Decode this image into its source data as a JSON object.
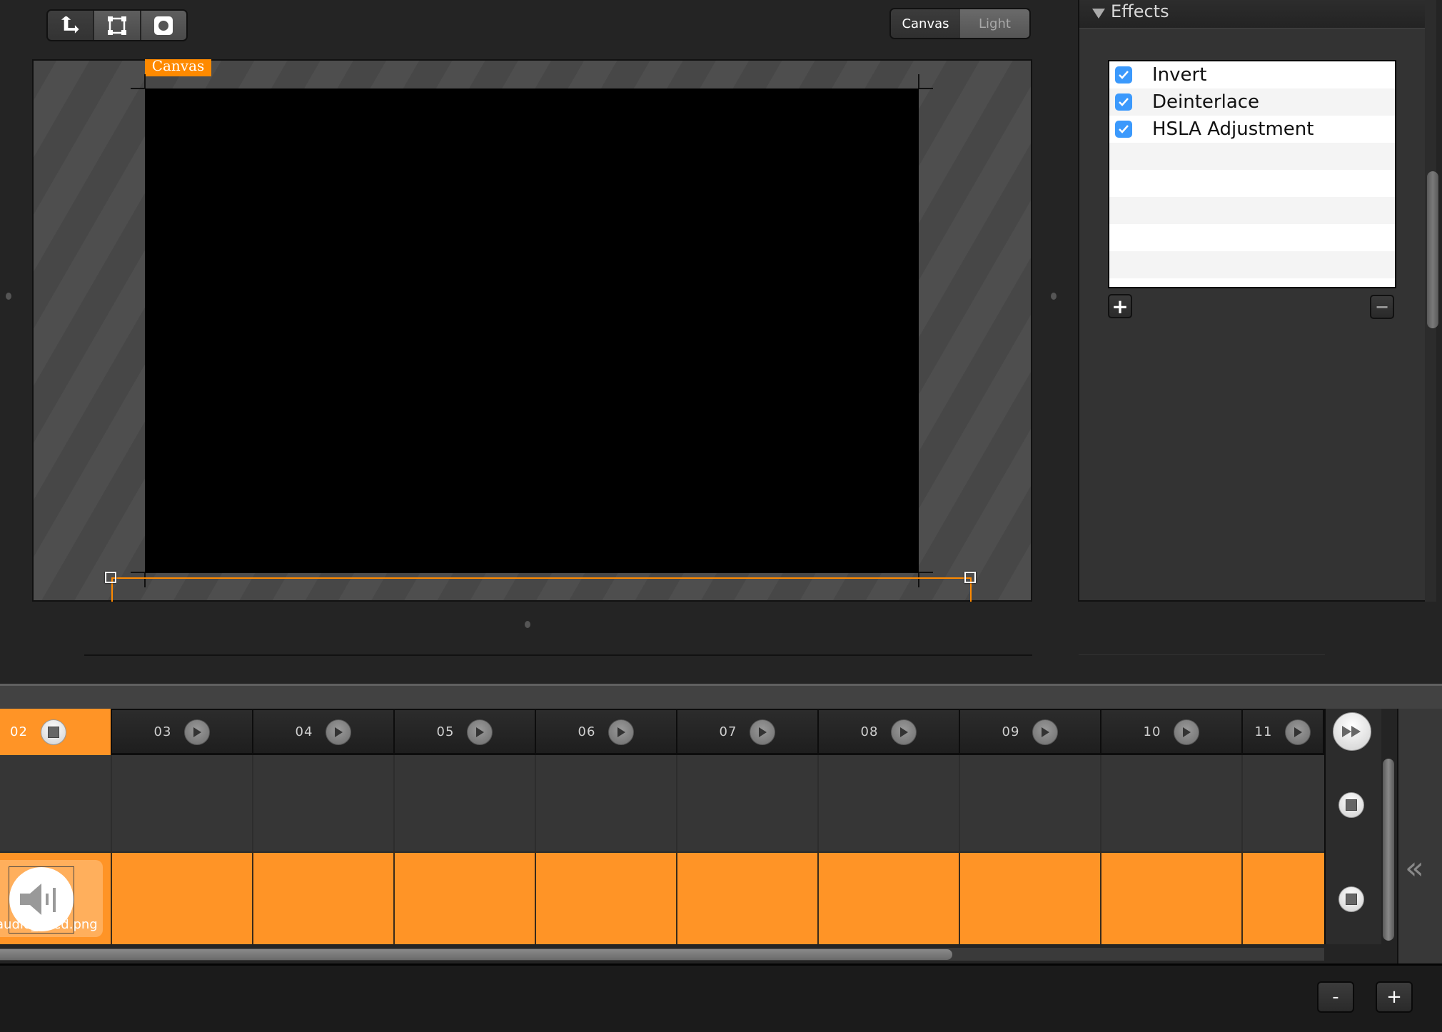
{
  "toolbar": {
    "tools": [
      {
        "name": "anchor-tool",
        "icon": "anchor-arrows-icon",
        "active": true
      },
      {
        "name": "transform-tool",
        "icon": "bounding-box-icon",
        "active": false
      },
      {
        "name": "mask-tool",
        "icon": "circle-mask-icon",
        "active": false
      }
    ]
  },
  "view_toggle": {
    "options": [
      "Canvas",
      "Light"
    ],
    "selected": "Canvas"
  },
  "stage": {
    "canvas_label": "Canvas",
    "canvas_color": "#000000",
    "accent": "#ff8a00"
  },
  "effects": {
    "title": "Effects",
    "items": [
      {
        "label": "Invert",
        "checked": true
      },
      {
        "label": "Deinterlace",
        "checked": true
      },
      {
        "label": "HSLA Adjustment",
        "checked": true
      }
    ],
    "add_label": "+",
    "remove_label": "−"
  },
  "timeline": {
    "columns": [
      {
        "label": "02",
        "state": "stop",
        "selected": true
      },
      {
        "label": "03",
        "state": "play"
      },
      {
        "label": "04",
        "state": "play"
      },
      {
        "label": "05",
        "state": "play"
      },
      {
        "label": "06",
        "state": "play"
      },
      {
        "label": "07",
        "state": "play"
      },
      {
        "label": "08",
        "state": "play"
      },
      {
        "label": "09",
        "state": "play"
      },
      {
        "label": "10",
        "state": "play"
      },
      {
        "label": "11",
        "state": "play"
      }
    ],
    "clip_name": "audio_filled.png",
    "clip_color": "#ff9426",
    "collapse_label": "«",
    "zoom_out_label": "-",
    "zoom_in_label": "+"
  }
}
